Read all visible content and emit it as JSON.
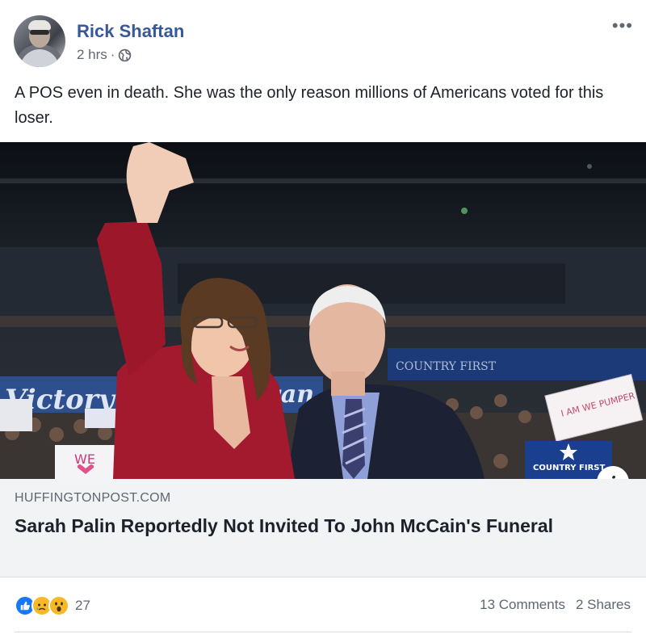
{
  "post": {
    "author": "Rick Shaftan",
    "timestamp": "2 hrs",
    "separator": "·",
    "privacy_icon": "globe-icon",
    "more_label": "•••",
    "text": "A POS even in death. She was the only reason millions of Americans voted for this loser."
  },
  "photo": {
    "sign_left_top": "Victory",
    "sign_left_right": "wan",
    "sign_we": "WE",
    "sign_banner": "COUNTRY FIRST",
    "sign_country": "COUNTRY FIRST",
    "sign_card": "I AM WE PUMPER"
  },
  "info_button": "i",
  "link_preview": {
    "domain": "HUFFINGTONPOST.COM",
    "title": "Sarah Palin Reportedly Not Invited To John McCain's Funeral"
  },
  "footer": {
    "reactions": [
      "like-icon",
      "sad-icon",
      "wow-icon"
    ],
    "reaction_count": "27",
    "comments": "13 Comments",
    "shares": "2 Shares"
  },
  "colors": {
    "name_link": "#385898",
    "secondary_text": "#606770",
    "link_box_bg": "#f2f3f5"
  }
}
